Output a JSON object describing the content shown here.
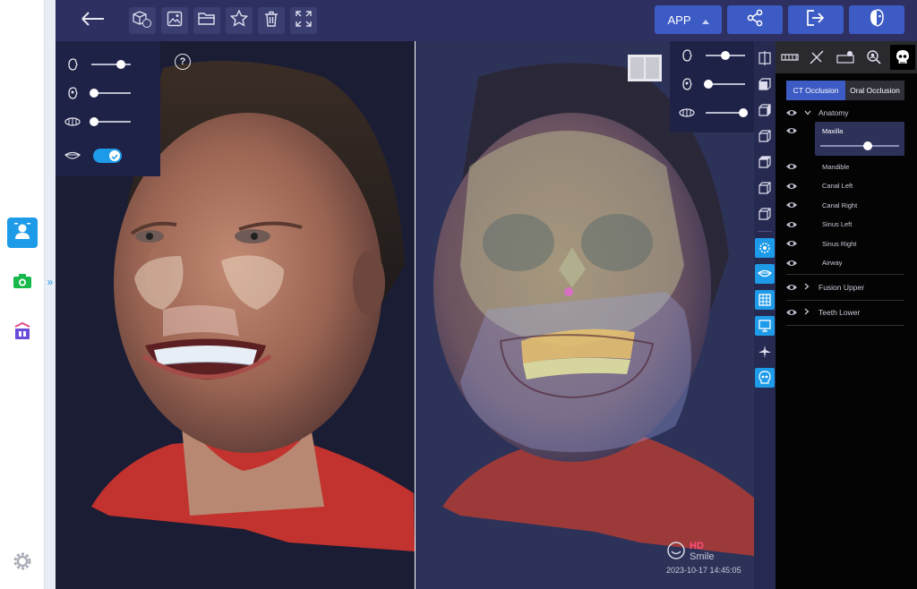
{
  "toolbar": {
    "app_label": "APP",
    "icons": [
      "back-arrow-icon",
      "cube-hd-icon",
      "image-icon",
      "folder-icon",
      "star-icon",
      "trash-icon",
      "fullscreen-icon",
      "share-icon",
      "export-icon",
      "face-compare-icon"
    ]
  },
  "sidebar": {
    "items": [
      "face-scan-icon",
      "camera-icon",
      "app-store-icon",
      "settings-icon"
    ]
  },
  "left_panel": {
    "sliders": [
      {
        "icon": "face-profile-icon",
        "value": 0.8
      },
      {
        "icon": "skull-profile-icon",
        "value": 0.0
      },
      {
        "icon": "teeth-icon",
        "value": 0.0
      }
    ],
    "lips_toggle": true
  },
  "right_panel_sliders": [
    {
      "icon": "face-profile-icon",
      "value": 0.5
    },
    {
      "icon": "skull-profile-icon",
      "value": 0.0
    },
    {
      "icon": "teeth-icon",
      "value": 1.0
    }
  ],
  "stamp": {
    "hd": "HD",
    "smile": "Smile",
    "date": "2023-10-17 14:45:05"
  },
  "panel": {
    "ct_occlusion": "CT Occlusion",
    "oral_occlusion": "Oral Occlusion",
    "anatomy": "Anatomy",
    "maxilla": "Maxilla",
    "maxilla_opacity": 0.7,
    "items": [
      "Mandible",
      "Canal Left",
      "Canal Right",
      "Sinus Left",
      "Sinus Right",
      "Airway"
    ],
    "fusion_upper": "Fusion Upper",
    "teeth_lower": "Teeth Lower"
  },
  "colors": {
    "toolbar": "#2d3060",
    "accent": "#1e9be8",
    "app_button": "#3d5bc4",
    "hd": "#ff4f7b"
  }
}
